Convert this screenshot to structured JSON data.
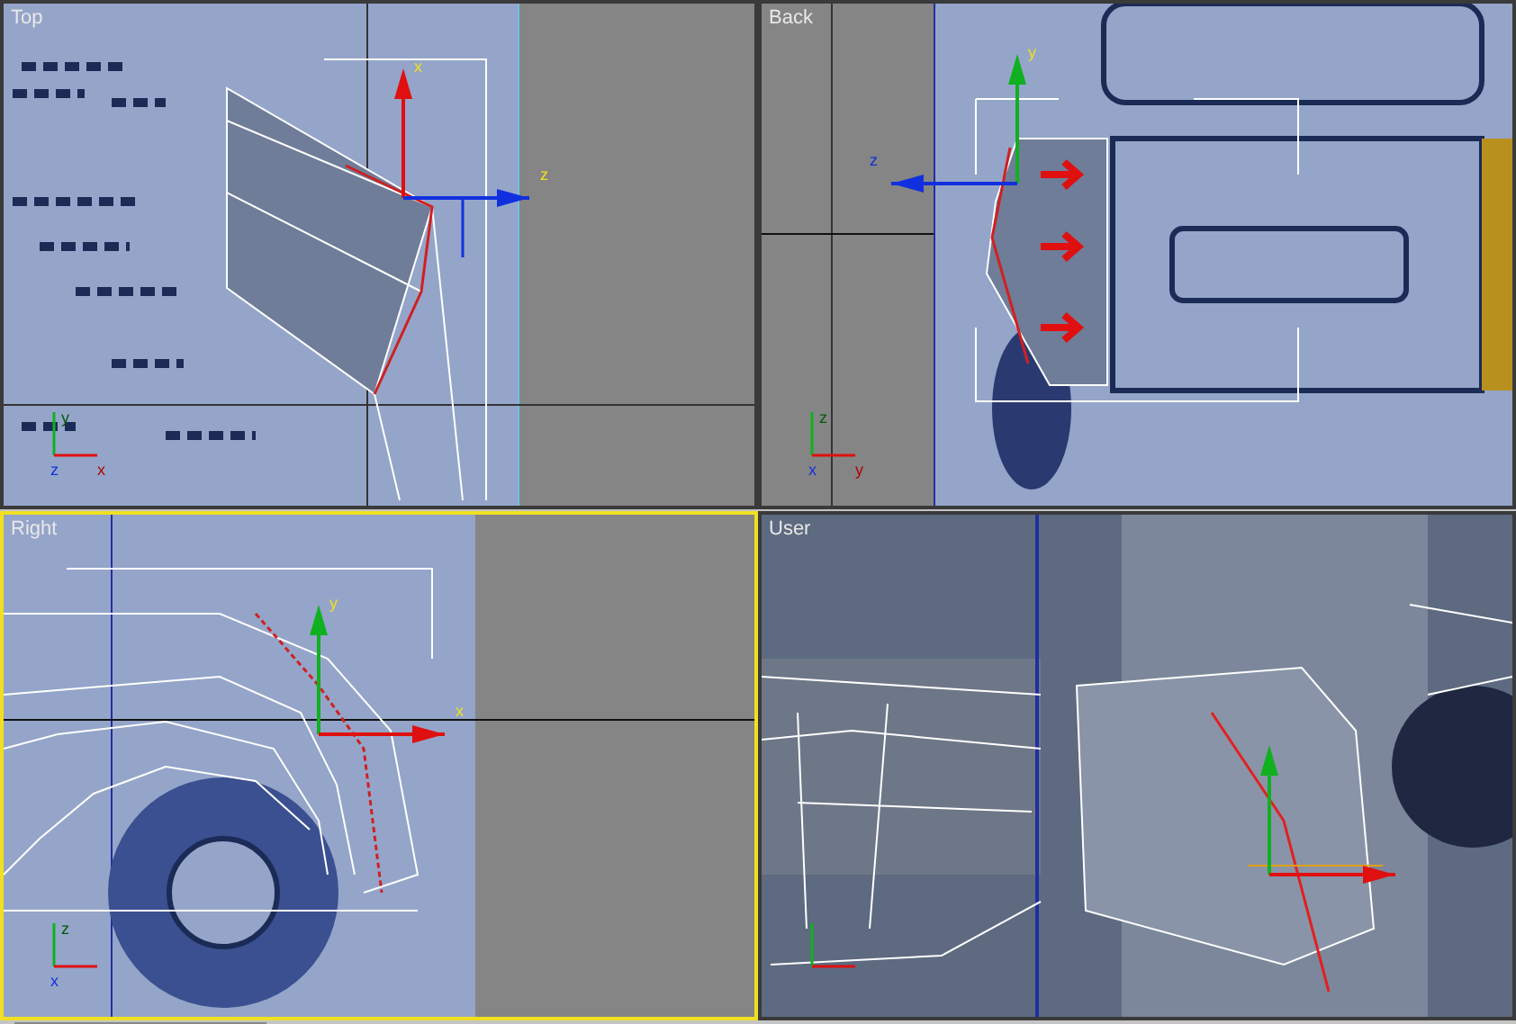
{
  "viewports": [
    {
      "label": "Top",
      "kind": "top",
      "selected": false,
      "gizmo_labels": [
        "x",
        "z"
      ],
      "corner_labels": [
        "y",
        "z",
        "x"
      ]
    },
    {
      "label": "Back",
      "kind": "back",
      "selected": false,
      "gizmo_labels": [
        "y",
        "z"
      ],
      "corner_labels": [
        "z",
        "x",
        "y"
      ]
    },
    {
      "label": "Right",
      "kind": "right",
      "selected": true,
      "gizmo_labels": [
        "y",
        "x"
      ],
      "corner_labels": [
        "z",
        "x"
      ]
    },
    {
      "label": "User",
      "kind": "user",
      "selected": false
    }
  ]
}
